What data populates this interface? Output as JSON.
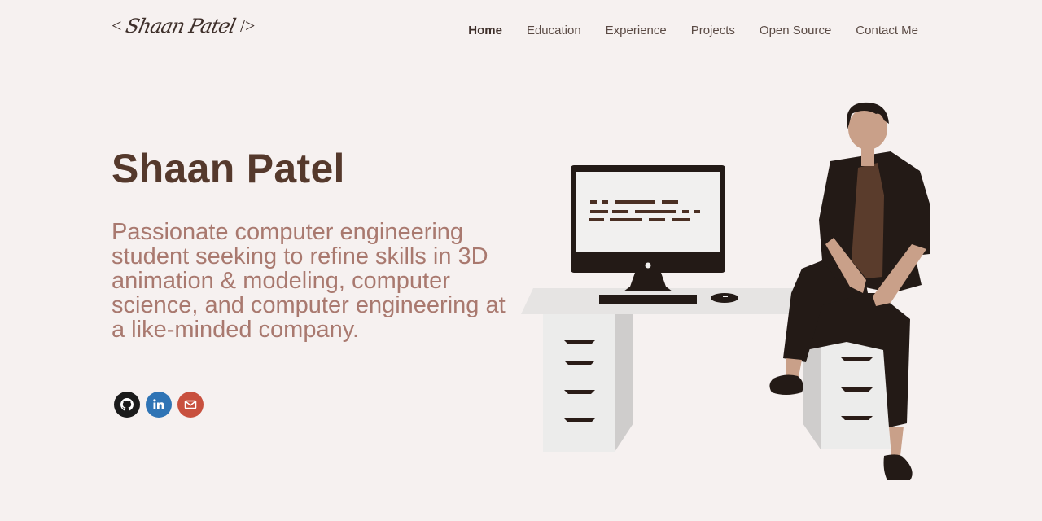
{
  "header": {
    "logo": {
      "open": "<",
      "signature": "Shaan Patel",
      "close": "/>"
    },
    "nav": [
      {
        "label": "Home",
        "active": true
      },
      {
        "label": "Education",
        "active": false
      },
      {
        "label": "Experience",
        "active": false
      },
      {
        "label": "Projects",
        "active": false
      },
      {
        "label": "Open Source",
        "active": false
      },
      {
        "label": "Contact Me",
        "active": false
      }
    ]
  },
  "hero": {
    "name": "Shaan Patel",
    "description": "Passionate computer engineering student seeking to refine skills in 3D animation & modeling, computer science, and computer engineering at a like-minded company.",
    "socials": [
      {
        "icon": "github-icon",
        "color": "#1b1b1b"
      },
      {
        "icon": "linkedin-icon",
        "color": "#2f74b5"
      },
      {
        "icon": "email-icon",
        "color": "#c8503e"
      }
    ]
  },
  "colors": {
    "background": "#f6f1f0",
    "name": "#55392c",
    "description": "#a9796f",
    "nav_text": "#5a4a44"
  }
}
